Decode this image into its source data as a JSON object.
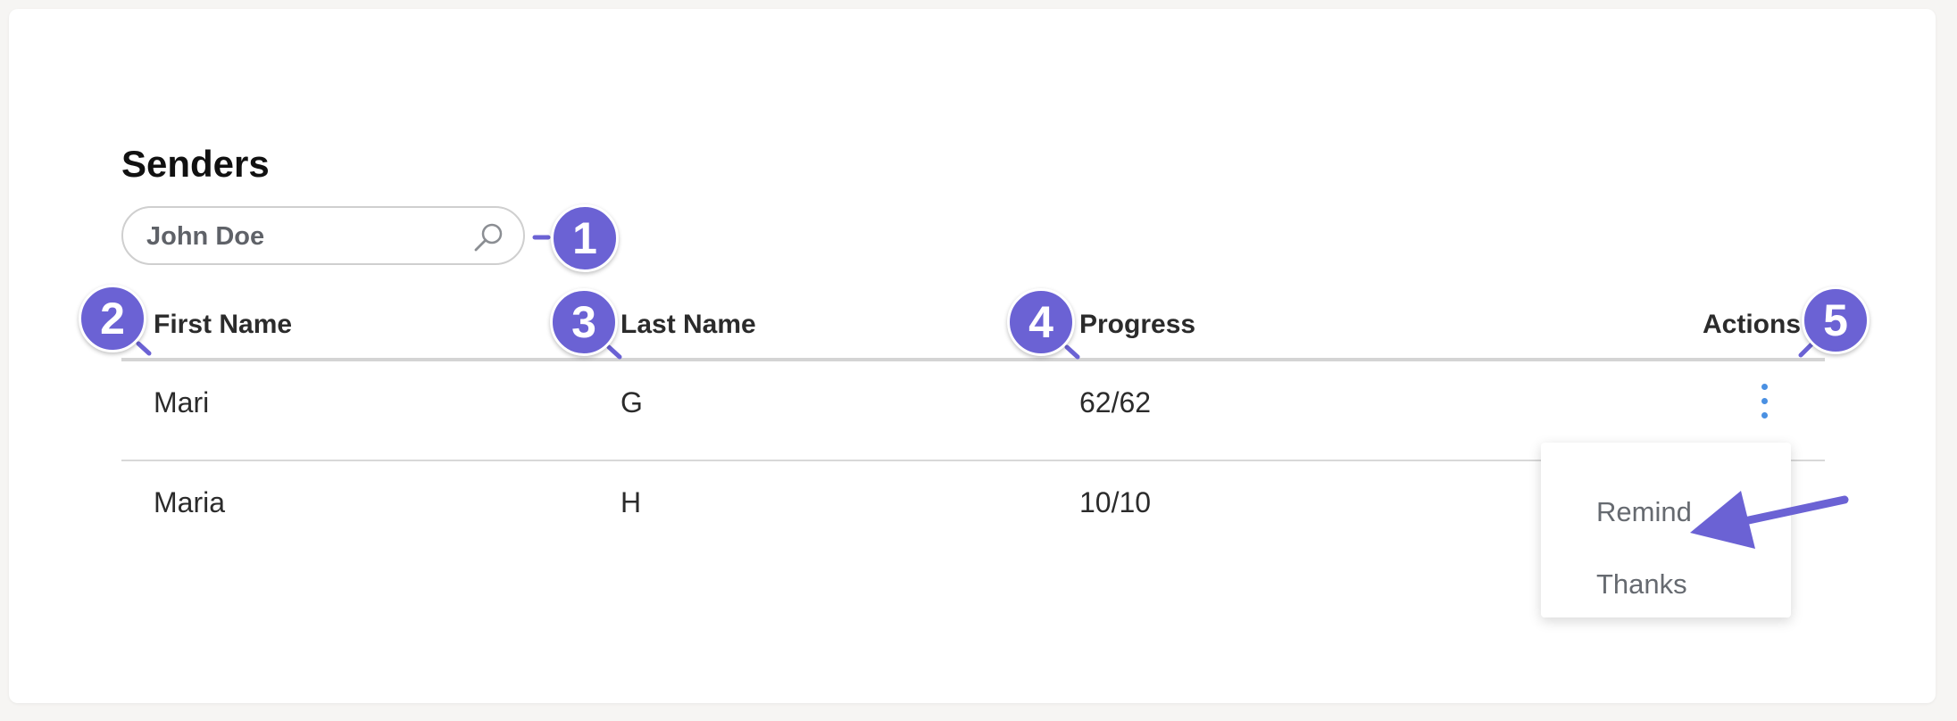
{
  "page": {
    "title": "Senders"
  },
  "search": {
    "value": "John Doe",
    "icon": "search-icon"
  },
  "table": {
    "columns": [
      "First Name",
      "Last Name",
      "Progress",
      "Actions"
    ],
    "rows": [
      {
        "first_name": "Mari",
        "last_name": "G",
        "progress": "62/62"
      },
      {
        "first_name": "Maria",
        "last_name": "H",
        "progress": "10/10"
      }
    ]
  },
  "actions_menu": {
    "items": [
      "Remind",
      "Thanks"
    ]
  },
  "annotations": {
    "badges": [
      "1",
      "2",
      "3",
      "4",
      "5"
    ],
    "color": "#6b62d4"
  },
  "colors": {
    "accent": "#4a90e2",
    "annotation": "#6b62d4"
  }
}
